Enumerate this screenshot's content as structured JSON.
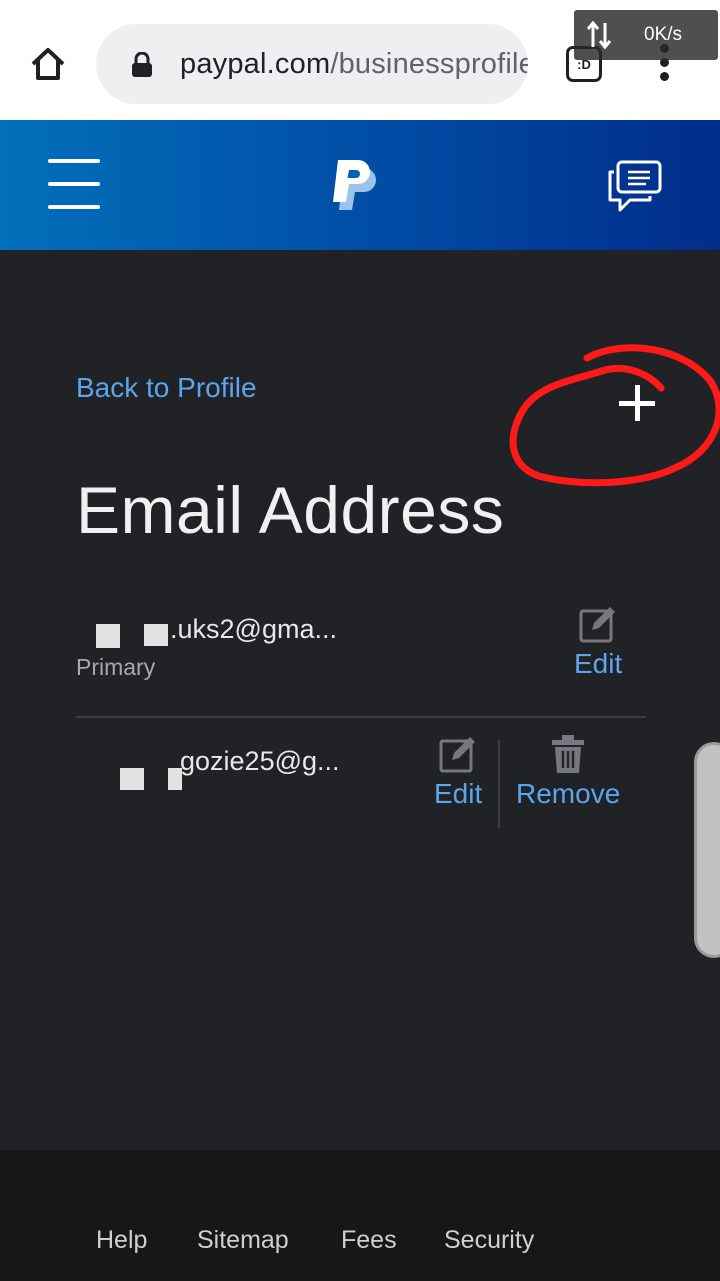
{
  "browser": {
    "url_domain": "paypal.com",
    "url_path": "/businessprofile",
    "tab_switcher_label": ":D",
    "net_speed": "0K/s"
  },
  "header": {
    "brand": "PayPal"
  },
  "main": {
    "back_link": "Back to Profile",
    "title": "Email Address",
    "emails": [
      {
        "address_visible": ".uks2@gma...",
        "label": "Primary",
        "actions": [
          "Edit"
        ]
      },
      {
        "address_visible": "gozie25@g...",
        "label": "",
        "actions": [
          "Edit",
          "Remove"
        ]
      }
    ]
  },
  "footer": {
    "links": [
      "Help",
      "Sitemap",
      "Fees",
      "Security"
    ]
  },
  "colors": {
    "link_blue": "#5ba5ec",
    "background": "#212226",
    "annotation_red": "#ff1a1a"
  }
}
